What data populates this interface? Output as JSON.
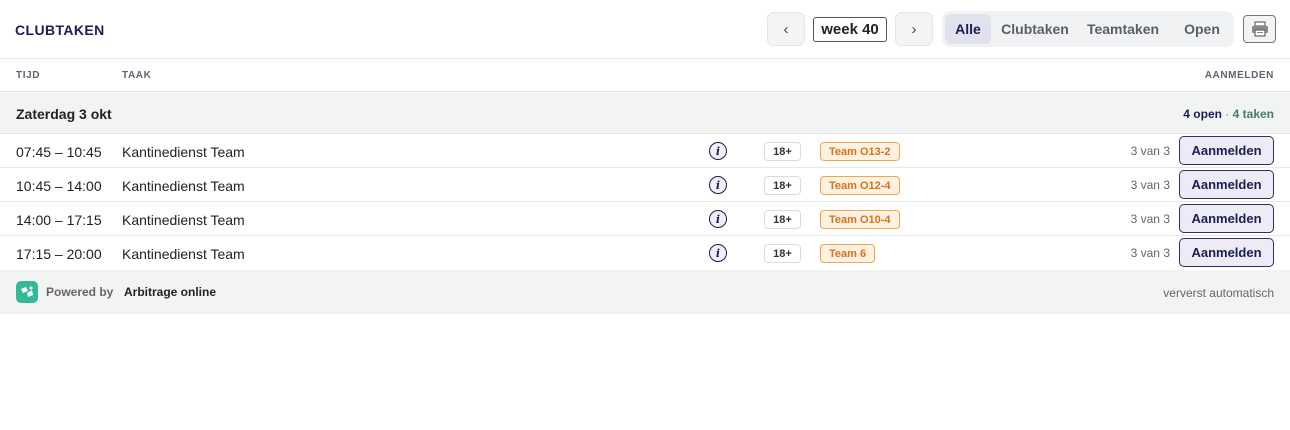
{
  "header": {
    "title": "CLUBTAKEN",
    "prev_label": "‹",
    "next_label": "›",
    "week_label": "week 40",
    "filters": [
      {
        "label": "Alle",
        "active": true
      },
      {
        "label": "Clubtaken",
        "active": false
      },
      {
        "label": "Teamtaken",
        "active": false
      },
      {
        "label": "Open",
        "active": false
      }
    ],
    "print_icon": "printer-icon"
  },
  "columns": {
    "time": "TIJD",
    "task": "TAAK",
    "signup": "AANMELDEN"
  },
  "group": {
    "title": "Zaterdag 3 okt",
    "open": "4 open",
    "separator": "·",
    "total": "4 taken"
  },
  "rows": [
    {
      "time": "07:45 – 10:45",
      "task": "Kantinedienst Team",
      "age": "18+",
      "team": "Team O13-2",
      "slots": "3 van 3",
      "button": "Aanmelden",
      "info_icon": "i"
    },
    {
      "time": "10:45 – 14:00",
      "task": "Kantinedienst Team",
      "age": "18+",
      "team": "Team O12-4",
      "slots": "3 van 3",
      "button": "Aanmelden",
      "info_icon": "i"
    },
    {
      "time": "14:00 – 17:15",
      "task": "Kantinedienst Team",
      "age": "18+",
      "team": "Team O10-4",
      "slots": "3 van 3",
      "button": "Aanmelden",
      "info_icon": "i"
    },
    {
      "time": "17:15 – 20:00",
      "task": "Kantinedienst Team",
      "age": "18+",
      "team": "Team 6",
      "slots": "3 van 3",
      "button": "Aanmelden",
      "info_icon": "i"
    }
  ],
  "footer": {
    "powered_label": "Powered by",
    "brand": "Arbitrage online",
    "refresh_note": "ververst automatisch",
    "logo_icon": "arbitrage-logo-icon"
  },
  "colors": {
    "accent": "#1c1d55",
    "team_badge_text": "#d9731a",
    "team_badge_bg": "#fdf1e2",
    "logo": "#35b79a"
  }
}
